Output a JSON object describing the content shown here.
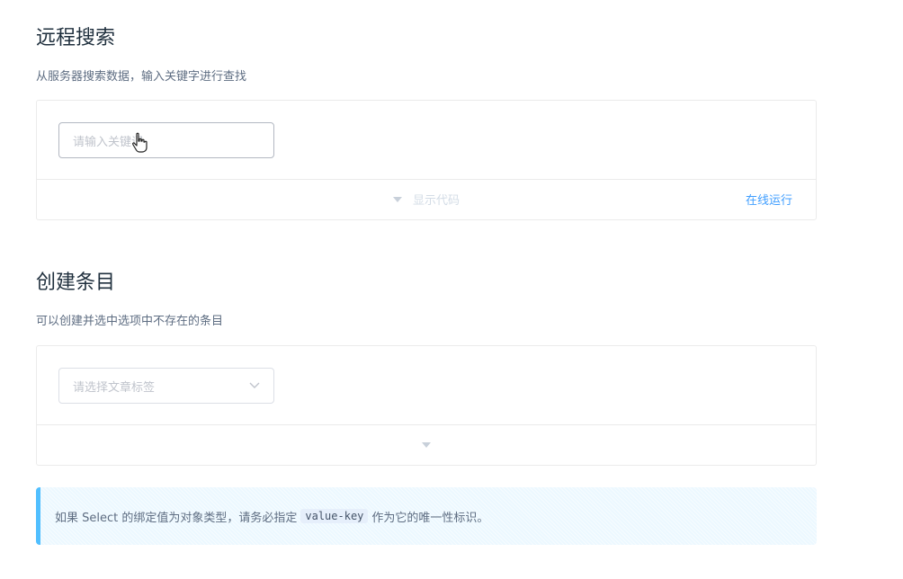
{
  "remote_search": {
    "title": "远程搜索",
    "description": "从服务器搜索数据，输入关键字进行查找",
    "input_placeholder": "请输入关键词",
    "show_code_label": "显示代码",
    "run_online_label": "在线运行"
  },
  "create_item": {
    "title": "创建条目",
    "description": "可以创建并选中选项中不存在的条目",
    "select_placeholder": "请选择文章标签"
  },
  "tip": {
    "text_before": "如果 Select 的绑定值为对象类型，请务必指定",
    "code": "value-key",
    "text_after": "作为它的唯一性标识。"
  },
  "icons": {
    "caret": "caret-down-icon",
    "chevron": "chevron-down-icon",
    "cursor": "hand-pointer-icon"
  },
  "colors": {
    "accent": "#409eff",
    "tip_border": "#50bfff",
    "tip_background": "#ecf8ff"
  }
}
